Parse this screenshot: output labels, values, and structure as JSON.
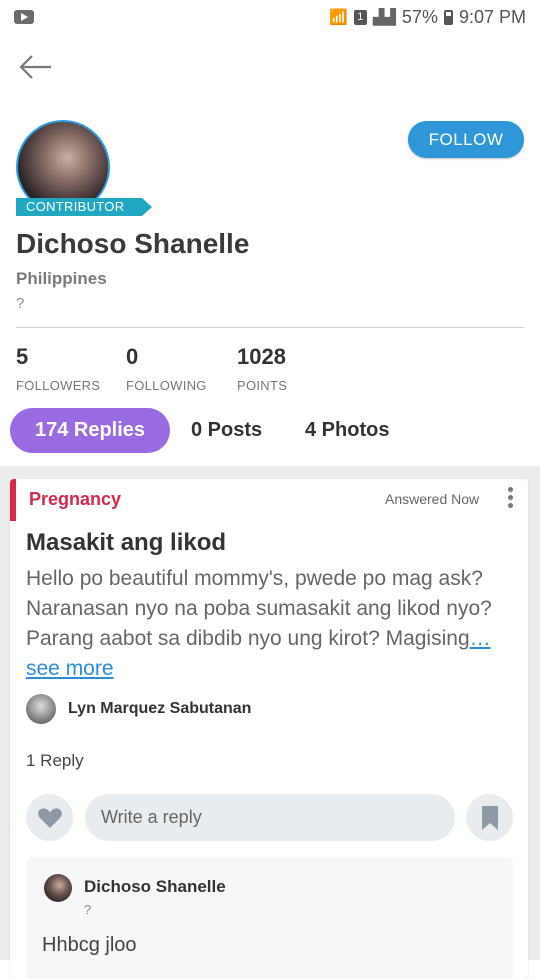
{
  "status_bar": {
    "battery": "57%",
    "time": "9:07 PM",
    "sim": "1"
  },
  "profile": {
    "badge": "CONTRIBUTOR",
    "follow_label": "FOLLOW",
    "name": "Dichoso Shanelle",
    "country": "Philippines",
    "bio": "?"
  },
  "stats": [
    {
      "value": "5",
      "label": "FOLLOWERS"
    },
    {
      "value": "0",
      "label": "FOLLOWING"
    },
    {
      "value": "1028",
      "label": "POINTS"
    }
  ],
  "tabs": [
    {
      "label": "174 Replies"
    },
    {
      "label": "0 Posts"
    },
    {
      "label": "4 Photos"
    }
  ],
  "post": {
    "category": "Pregnancy",
    "answered": "Answered Now",
    "title": "Masakit ang likod",
    "body": "Hello po beautiful mommy's, pwede po mag ask? Naranasan nyo na poba sumasakit ang likod nyo?  Parang aabot sa dibdib nyo ung kirot? Magising",
    "see_more": "… see more",
    "author": "Lyn Marquez Sabutanan",
    "reply_count": "1 Reply",
    "reply_placeholder": "Write a reply"
  },
  "reply": {
    "author": "Dichoso Shanelle",
    "sub": "?",
    "text": "Hhbcg jloo"
  },
  "colors": {
    "accent_blue": "#2f97d8",
    "tab_purple": "#9a6be0",
    "category_red": "#cf2a4f",
    "badge_teal": "#22a7c0"
  }
}
